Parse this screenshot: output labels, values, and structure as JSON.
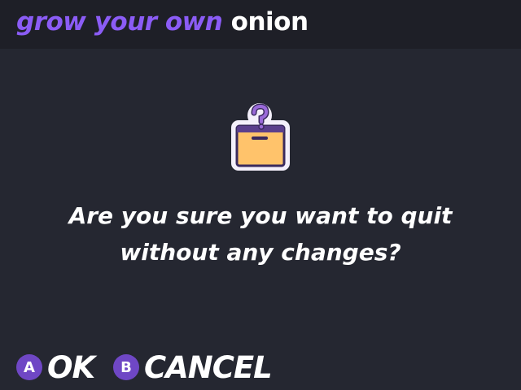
{
  "header": {
    "title_accent": "grow your own",
    "title_main": "onion",
    "accent_color": "#8b5cf6"
  },
  "dialog": {
    "icon": "question-box-icon",
    "message_line1": "Are you sure you want to quit",
    "message_line2": "without any changes?"
  },
  "footer": {
    "ok": {
      "key": "A",
      "label": "OK"
    },
    "cancel": {
      "key": "B",
      "label": "CANCEL"
    },
    "key_color": "#6f47c5"
  }
}
